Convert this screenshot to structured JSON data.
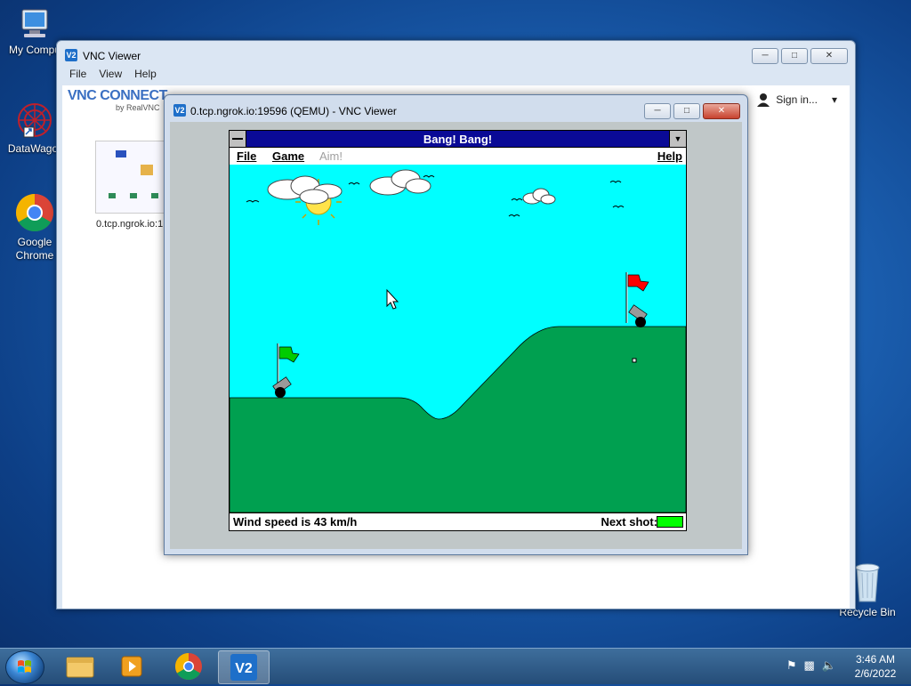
{
  "desktop": {
    "icons": [
      {
        "label": "My Compu"
      },
      {
        "label": "DataWagor"
      },
      {
        "label": "Google Chrome"
      },
      {
        "label": "Recycle Bin"
      }
    ]
  },
  "vnc_viewer": {
    "title": "VNC Viewer",
    "menu": [
      "File",
      "View",
      "Help"
    ],
    "logo_text": "VNC CONNECT",
    "logo_sub": "by RealVNC",
    "sign_in": "Sign in...",
    "thumbnail_label": "0.tcp.ngrok.io:1"
  },
  "qemu_window": {
    "title": "0.tcp.ngrok.io:19596 (QEMU) - VNC Viewer"
  },
  "game": {
    "title": "Bang! Bang!",
    "menu": {
      "file": "File",
      "game": "Game",
      "aim": "Aim!",
      "help": "Help"
    },
    "wind_text": "Wind speed is 43 km/h",
    "next_shot_label": "Next shot:",
    "colors": {
      "sky": "#00ffff",
      "ground": "#00a050",
      "player_flag": "#00cc00",
      "enemy_flag": "#ff0000",
      "next_shot": "#00ff00"
    }
  },
  "taskbar": {
    "time": "3:46 AM",
    "date": "2/6/2022",
    "pinned": [
      "explorer-icon",
      "media-player-icon",
      "chrome-icon",
      "vnc-viewer-icon"
    ]
  }
}
